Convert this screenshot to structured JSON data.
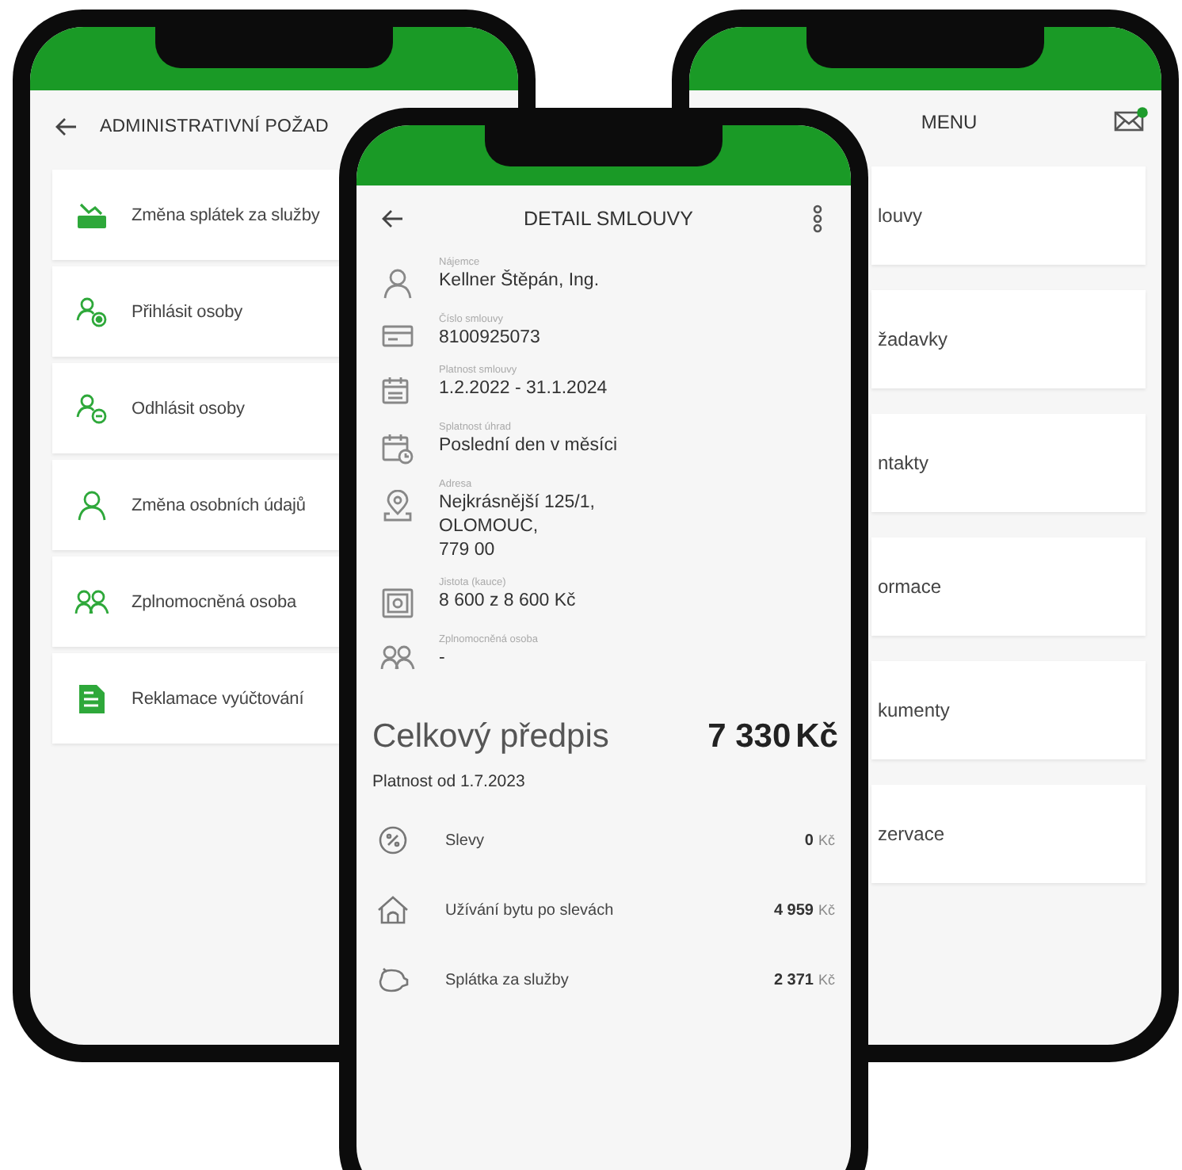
{
  "admin_screen": {
    "title": "ADMINISTRATIVNÍ POŽAD",
    "items": [
      {
        "label": "Změna splátek za služby"
      },
      {
        "label": "Přihlásit osoby"
      },
      {
        "label": "Odhlásit osoby"
      },
      {
        "label": "Změna osobních údajů"
      },
      {
        "label": "Zplnomocněná osoba"
      },
      {
        "label": "Reklamace vyúčtování"
      }
    ]
  },
  "contract_screen": {
    "title": "DETAIL SMLOUVY",
    "fields": [
      {
        "label": "Nájemce",
        "lines": [
          "Kellner Štěpán, Ing."
        ]
      },
      {
        "label": "Číslo smlouvy",
        "lines": [
          "8100925073"
        ]
      },
      {
        "label": "Platnost smlouvy",
        "lines": [
          "1.2.2022 - 31.1.2024"
        ]
      },
      {
        "label": "Splatnost úhrad",
        "lines": [
          "Poslední den v měsíci"
        ]
      },
      {
        "label": "Adresa",
        "lines": [
          "Nejkrásnější 125/1,",
          "OLOMOUC,",
          "779 00"
        ]
      },
      {
        "label": "Jistota (kauce)",
        "lines": [
          "8 600 z 8 600 Kč"
        ]
      },
      {
        "label": "Zplnomocněná osoba",
        "lines": [
          "-"
        ]
      }
    ],
    "summary": {
      "title": "Celkový předpis",
      "total": "7 330",
      "currency": "Kč",
      "validity": "Platnost od 1.7.2023",
      "items": [
        {
          "label": "Slevy",
          "amount": "0",
          "currency": "Kč"
        },
        {
          "label": "Užívání bytu po slevách",
          "amount": "4 959",
          "currency": "Kč"
        },
        {
          "label": "Splátka za služby",
          "amount": "2 371",
          "currency": "Kč"
        }
      ]
    }
  },
  "menu_screen": {
    "title": "MENU",
    "unread_messages": true,
    "items": [
      {
        "label": "louvy"
      },
      {
        "label": "žadavky"
      },
      {
        "label": "ntakty"
      },
      {
        "label": "ormace"
      },
      {
        "label": "kumenty"
      },
      {
        "label": "zervace"
      }
    ]
  }
}
